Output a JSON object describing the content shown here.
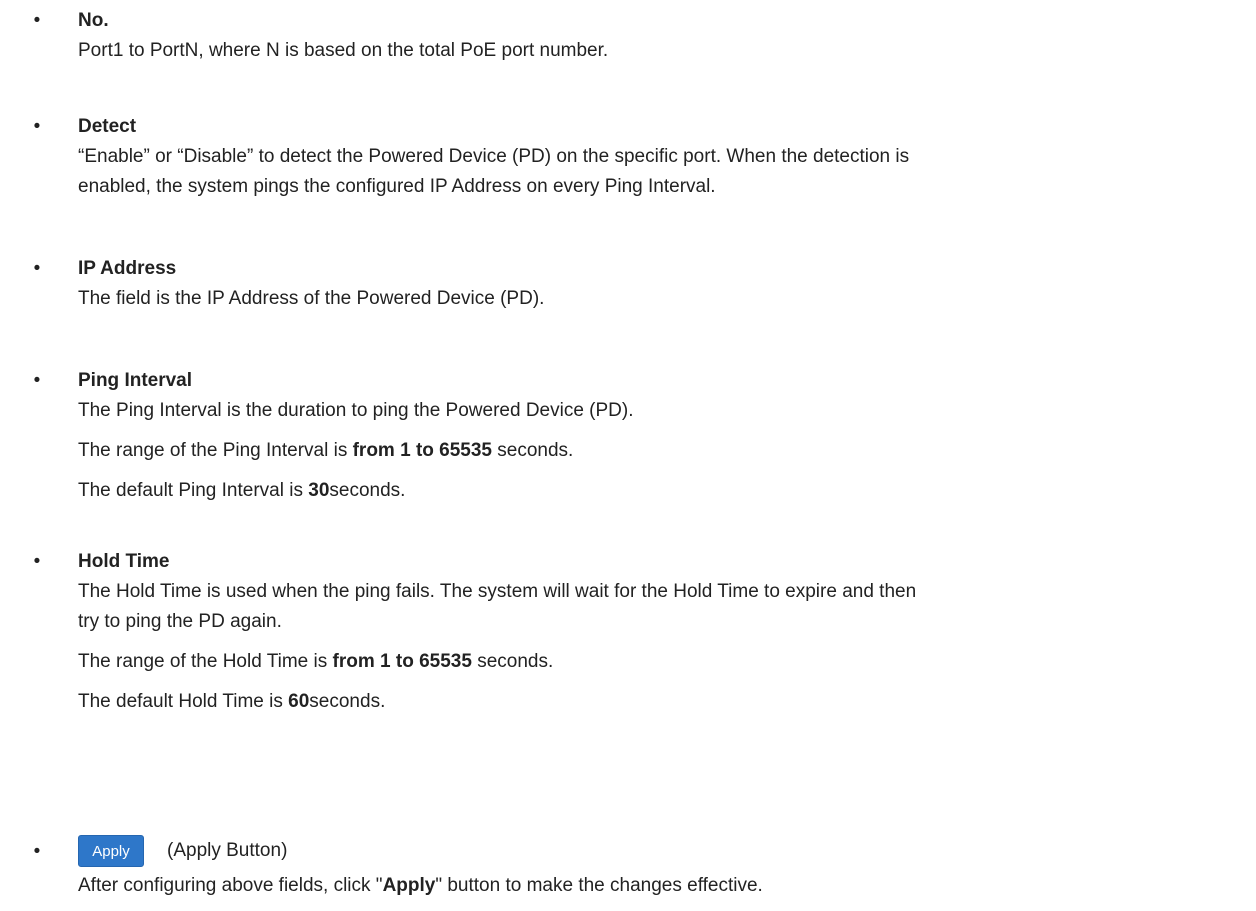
{
  "bullet_glyph": "•",
  "sections": {
    "no": {
      "term": "No.",
      "desc": "Port1 to PortN, where N is based on the total PoE port number."
    },
    "detect": {
      "term": "Detect",
      "desc_line1": "“Enable” or “Disable” to detect the Powered Device (PD) on the specific port. When the detection is",
      "desc_line2": "enabled, the system pings the configured IP Address on every Ping Interval."
    },
    "ip_address": {
      "term": "IP Address",
      "desc": "The field is the IP Address of the Powered Device (PD)."
    },
    "ping_interval": {
      "term": "Ping Interval",
      "desc": "The Ping Interval is the duration to ping the Powered Device (PD).",
      "range_prefix": "The range of the Ping Interval is ",
      "range_bold": "from 1 to 65535",
      "range_suffix": " seconds.",
      "default_prefix": "The default Ping Interval is ",
      "default_bold": "30",
      "default_suffix": "seconds."
    },
    "hold_time": {
      "term": "Hold Time",
      "desc_line1": "The Hold Time is used when the ping fails. The system will wait for the Hold Time to expire and then",
      "desc_line2": "try to ping the PD again.",
      "range_prefix": "The range of the Hold Time is ",
      "range_bold": "from 1 to 65535",
      "range_suffix": " seconds.",
      "default_prefix": "The default Hold Time is ",
      "default_bold": "60",
      "default_suffix": "seconds."
    },
    "apply": {
      "button_label": "Apply",
      "caption": "(Apply Button)",
      "desc_prefix": "After configuring above fields, click \"",
      "desc_bold": "Apply",
      "desc_suffix": "\" button to make the changes effective."
    }
  },
  "colors": {
    "text": "#222222",
    "button_bg": "#2e77c9",
    "button_text": "#ffffff"
  }
}
